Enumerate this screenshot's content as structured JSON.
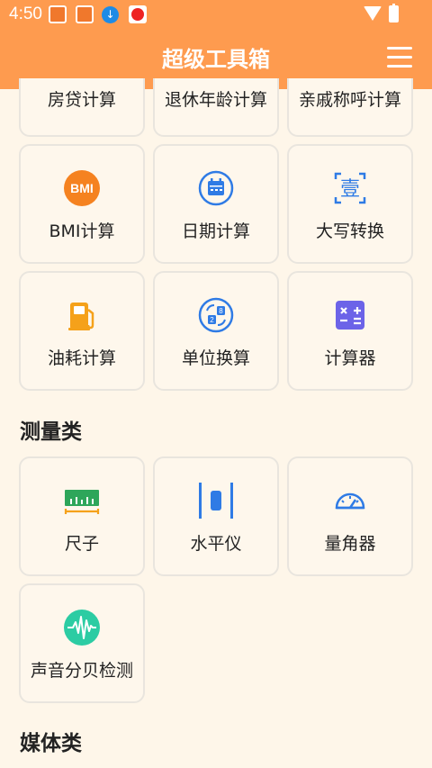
{
  "status": {
    "time": "4:50"
  },
  "app": {
    "title": "超级工具箱"
  },
  "row0": [
    "房贷计算",
    "退休年龄计算",
    "亲戚称呼计算"
  ],
  "row1": [
    "BMI计算",
    "日期计算",
    "大写转换"
  ],
  "row2": [
    "油耗计算",
    "单位换算",
    "计算器"
  ],
  "measure": {
    "title": "测量类",
    "items": [
      "尺子",
      "水平仪",
      "量角器",
      "声音分贝检测"
    ]
  },
  "media": {
    "title": "媒体类"
  },
  "icons": {
    "bmi_text": "BMI",
    "upper_text": "壹",
    "unit_text": "2",
    "unit_text2": "8"
  },
  "colors": {
    "accent": "#FE9B4F",
    "background": "#FEF6E9",
    "blue": "#2F7BE5",
    "orange": "#F58220",
    "green": "#2EA65A",
    "teal": "#2CCCA3",
    "purple": "#6C63E8"
  }
}
